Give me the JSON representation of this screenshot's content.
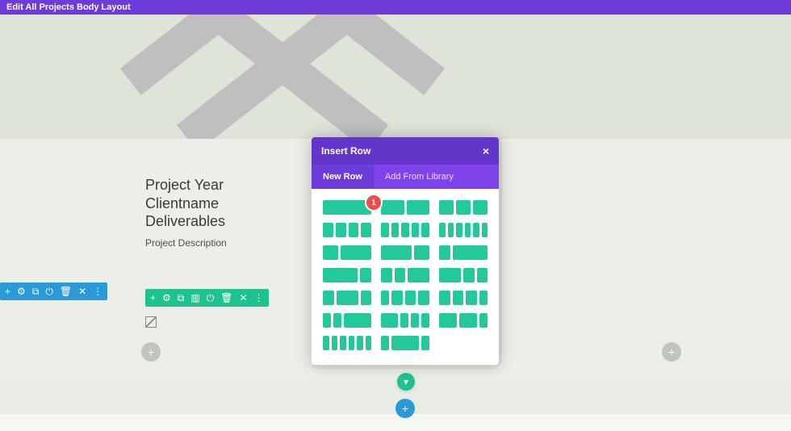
{
  "top_bar": {
    "title": "Edit All Projects Body Layout"
  },
  "project": {
    "year_label": "Project Year",
    "client_label": "Clientname",
    "deliverables_label": "Deliverables",
    "description_label": "Project Description"
  },
  "section_toolbar": {
    "icons": [
      "add-icon",
      "gear-icon",
      "duplicate-icon",
      "power-icon",
      "trash-icon",
      "close-icon",
      "more-icon"
    ]
  },
  "row_toolbar": {
    "icons": [
      "add-icon",
      "gear-icon",
      "duplicate-icon",
      "columns-icon",
      "power-icon",
      "trash-icon",
      "close-icon",
      "more-icon"
    ]
  },
  "add_buttons": {
    "plus": "+"
  },
  "modal": {
    "title": "Insert Row",
    "close_glyph": "×",
    "tabs": {
      "new_row": "New Row",
      "from_library": "Add From Library"
    },
    "badge": "1",
    "layouts": [
      [
        1
      ],
      [
        2
      ],
      [
        3
      ],
      [
        4
      ],
      [
        5
      ],
      [
        6
      ],
      [
        "1-2"
      ],
      [
        "2-1"
      ],
      [
        "1-3"
      ],
      [
        "3-1"
      ],
      [
        "1-1-2"
      ],
      [
        "2-1-1"
      ],
      [
        "1-2-1"
      ],
      [
        "1-4"
      ],
      [
        "4-1"
      ],
      [
        "1-1-3"
      ],
      [
        "t-l"
      ],
      [
        "t-r"
      ],
      [
        "six-n"
      ],
      [
        "1-w-1"
      ]
    ]
  }
}
